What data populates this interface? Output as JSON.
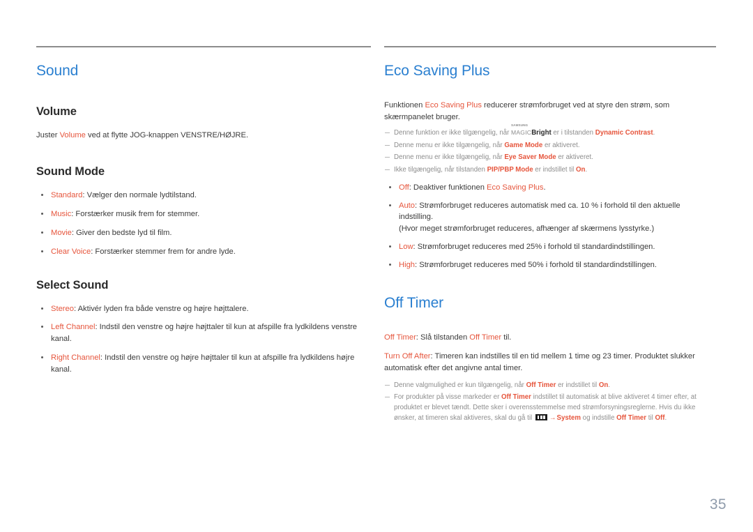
{
  "page": {
    "number": "35"
  },
  "left": {
    "section_title": "Sound",
    "volume": {
      "title": "Volume",
      "line_pre": "Juster ",
      "line_hl": "Volume",
      "line_post": " ved at flytte JOG-knappen VENSTRE/HØJRE."
    },
    "sound_mode": {
      "title": "Sound Mode",
      "items": [
        {
          "term": "Standard",
          "desc": ": Vælger den normale lydtilstand."
        },
        {
          "term": "Music",
          "desc": ": Forstærker musik frem for stemmer."
        },
        {
          "term": "Movie",
          "desc": ": Giver den bedste lyd til film."
        },
        {
          "term": "Clear Voice",
          "desc": ": Forstærker stemmer frem for andre lyde."
        }
      ]
    },
    "select_sound": {
      "title": "Select Sound",
      "items": [
        {
          "term": "Stereo",
          "desc": ": Aktivér lyden fra både venstre og højre højttalere."
        },
        {
          "term": "Left Channel",
          "desc": ": Indstil den venstre og højre højttaler til kun at afspille fra lydkildens venstre kanal."
        },
        {
          "term": "Right Channel",
          "desc": ": Indstil den venstre og højre højttaler til kun at afspille fra lydkildens højre kanal."
        }
      ]
    }
  },
  "right": {
    "eco": {
      "section_title": "Eco Saving Plus",
      "intro_pre": "Funktionen ",
      "intro_hl": "Eco Saving Plus",
      "intro_post": " reducerer strømforbruget ved at styre den strøm, som skærmpanelet bruger.",
      "notes": {
        "n1_pre": "Denne funktion er ikke tilgængelig, når ",
        "n1_logo_sams": "SAMSUNG",
        "n1_logo_magic": "MAGIC",
        "n1_bright": "Bright",
        "n1_mid": " er i tilstanden ",
        "n1_hl": "Dynamic Contrast",
        "n1_end": ".",
        "n2_pre": "Denne menu er ikke tilgængelig, når ",
        "n2_hl": "Game Mode",
        "n2_post": " er aktiveret.",
        "n3_pre": "Denne menu er ikke tilgængelig, når ",
        "n3_hl": "Eye Saver Mode",
        "n3_post": " er aktiveret.",
        "n4_pre": "Ikke tilgængelig, når tilstanden ",
        "n4_hl": "PIP/PBP Mode",
        "n4_mid": " er indstillet til ",
        "n4_hl2": "On",
        "n4_end": "."
      },
      "items": [
        {
          "term": "Off",
          "desc_pre": ": Deaktiver funktionen ",
          "desc_hl": "Eco Saving Plus",
          "desc_post": "."
        },
        {
          "term": "Auto",
          "desc_pre": ": Strømforbruget reduceres automatisk med ca. 10 % i forhold til den aktuelle indstilling.",
          "desc_hl": "",
          "desc_post": "",
          "second_line": "(Hvor meget strømforbruget reduceres, afhænger af skærmens lysstyrke.)"
        },
        {
          "term": "Low",
          "desc_pre": ": Strømforbruget reduceres med 25% i forhold til standardindstillingen.",
          "desc_hl": "",
          "desc_post": ""
        },
        {
          "term": "High",
          "desc_pre": ": Strømforbruget reduceres med 50% i forhold til standardindstillingen.",
          "desc_hl": "",
          "desc_post": ""
        }
      ]
    },
    "off_timer": {
      "section_title": "Off Timer",
      "p1_hl": "Off Timer",
      "p1_mid": ": Slå tilstanden ",
      "p1_hl2": "Off Timer",
      "p1_end": " til.",
      "p2_hl": "Turn Off After",
      "p2_text": ": Timeren kan indstilles til en tid mellem 1 time og 23 timer. Produktet slukker automatisk efter det angivne antal timer.",
      "notes": {
        "n1_pre": "Denne valgmulighed er kun tilgængelig, når ",
        "n1_hl": "Off Timer",
        "n1_mid": " er indstillet til ",
        "n1_hl2": "On",
        "n1_end": ".",
        "n2_pre": "For produkter på visse markeder er ",
        "n2_hl": "Off Timer",
        "n2_mid": " indstillet til automatisk at blive aktiveret 4 timer efter, at produktet er blevet tændt. Dette sker i overensstemmelse med strømforsyningsreglerne. Hvis du ikke ønsker, at timeren skal aktiveres, skal du gå til ",
        "n2_icon": "menu-icon",
        "n2_arrow": "→",
        "n2_hl2": "System",
        "n2_mid2": " og indstille ",
        "n2_hl3": "Off Timer",
        "n2_mid3": " til ",
        "n2_hl4": "Off",
        "n2_end": "."
      }
    }
  },
  "colors": {
    "heading_blue": "#2a7fd0",
    "accent_orange": "#e6553c",
    "body_text": "#3b3b3b",
    "note_text": "#8d8d8d",
    "page_number": "#8f9bab",
    "rule": "#8c8c8c"
  }
}
